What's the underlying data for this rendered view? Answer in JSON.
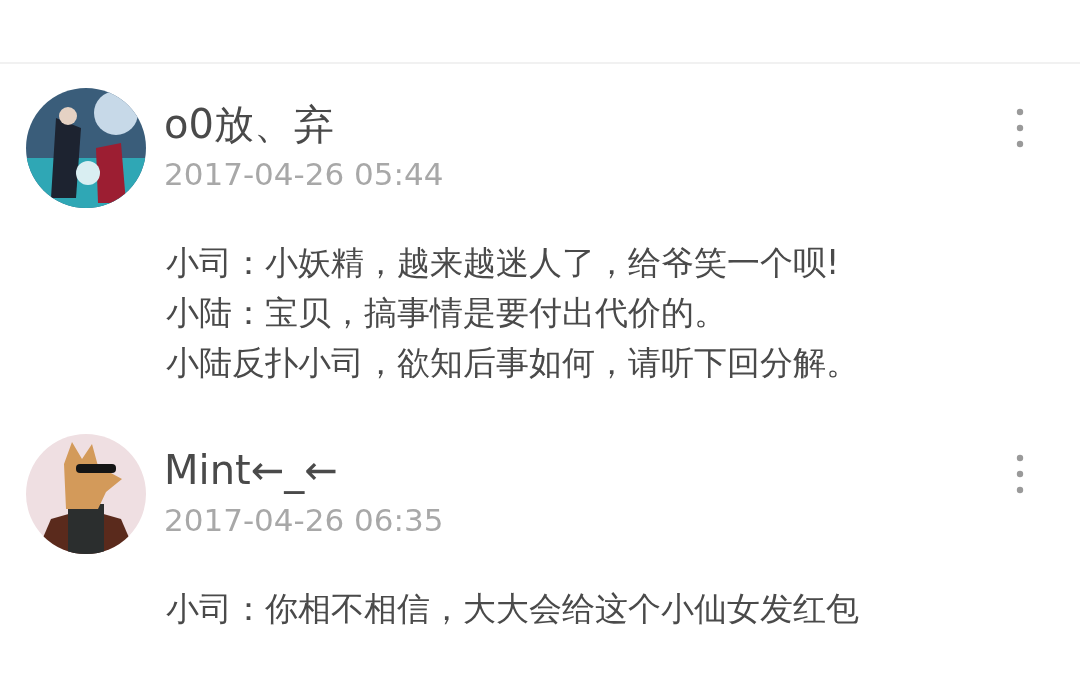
{
  "comments": [
    {
      "author": "o0放、弃",
      "time": "2017-04-26 05:44",
      "avatar": {
        "kind": "picture"
      },
      "lines": [
        "小司：小妖精，越来越迷人了，给爷笑一个呗!",
        "小陆：宝贝，搞事情是要付出代价的。",
        "小陆反扑小司，欲知后事如何，请听下回分解。"
      ]
    },
    {
      "author": "Mint←_←",
      "time": "2017-04-26 06:35",
      "avatar": {
        "kind": "picture"
      },
      "lines": [
        "小司：你相不相信，大大会给这个小仙女发红包"
      ]
    }
  ]
}
